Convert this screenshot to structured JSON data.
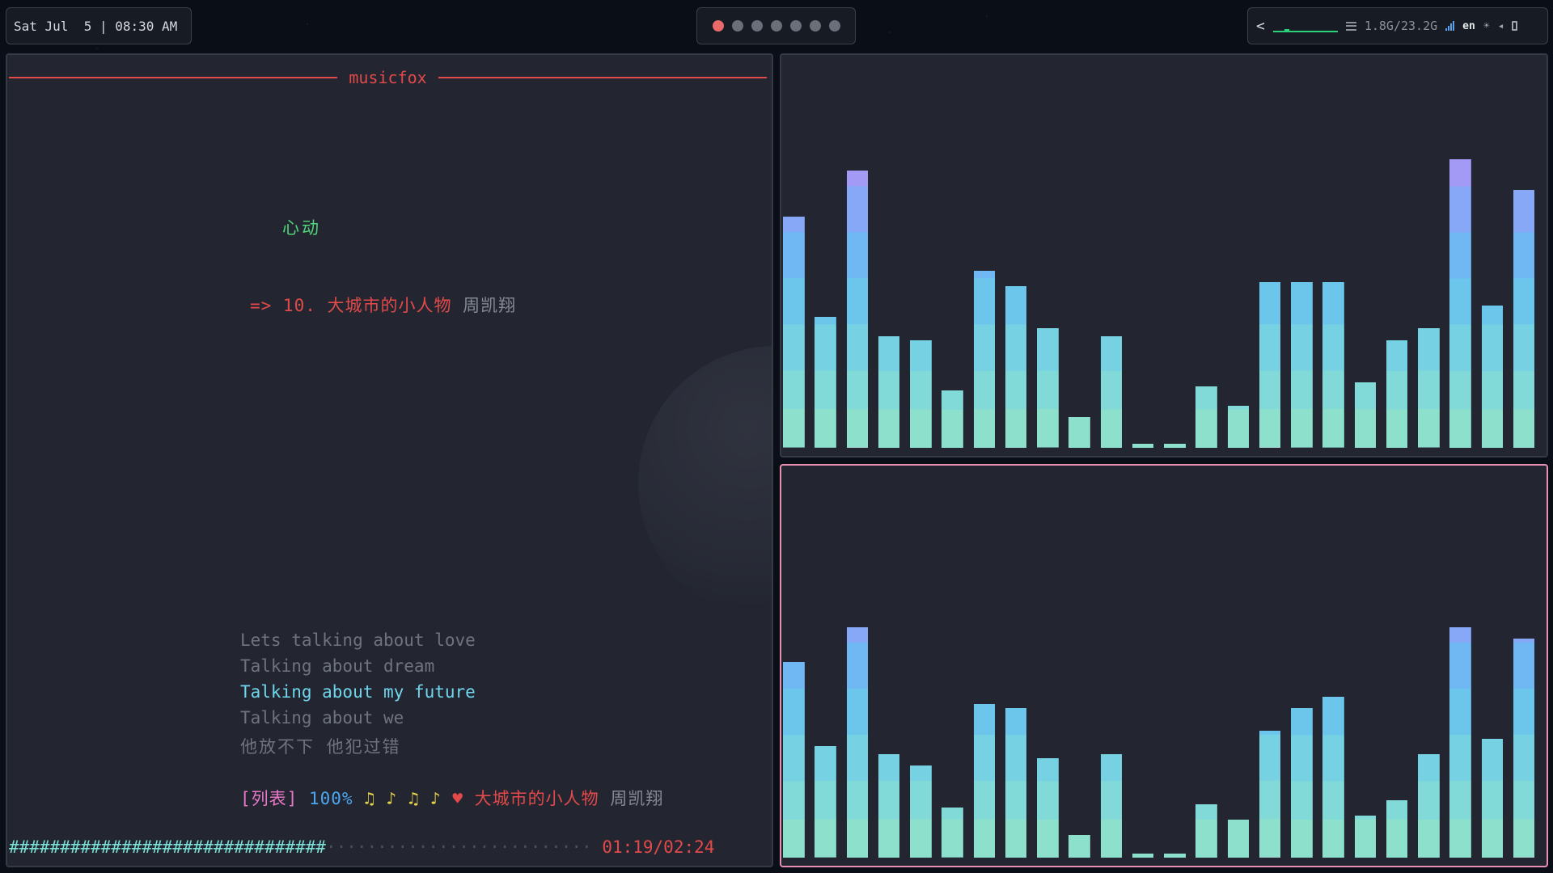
{
  "topbar": {
    "clock": "Sat Jul  5 | 08:30 AM",
    "workspaces": {
      "count": 7,
      "active_index": 0,
      "active_color": "#ea6a6a"
    },
    "tray": {
      "chevron": "<",
      "memory": "1.8G/23.2G",
      "lang": "en",
      "sun_glyph": "☀",
      "volume_glyph": "◂"
    }
  },
  "player": {
    "app_title": "musicfox",
    "playlist_name": "心动",
    "current_entry": {
      "prefix": "=> 10. 大城市的小人物",
      "artist": "周凯翔"
    },
    "lyrics": [
      "Lets talking about love",
      "Talking about dream",
      "Talking about my future",
      "Talking about we",
      "他放不下 他犯过错"
    ],
    "active_lyric_index": 2,
    "status": {
      "mode": "[列表]",
      "volume": "100%",
      "notes": "♫ ♪ ♫ ♪",
      "heart": "♥",
      "song": "大城市的小人物",
      "artist": "周凯翔"
    },
    "progress": {
      "done": "###############################",
      "rest": "··························",
      "time": "01:19/02:24",
      "fraction": 0.549
    }
  },
  "visualizer": {
    "top_levels": [
      0.6,
      0.34,
      0.72,
      0.29,
      0.28,
      0.15,
      0.46,
      0.42,
      0.31,
      0.08,
      0.29,
      0.01,
      0.01,
      0.16,
      0.11,
      0.43,
      0.43,
      0.43,
      0.17,
      0.28,
      0.31,
      0.75,
      0.37,
      0.67
    ],
    "bottom_levels": [
      0.51,
      0.29,
      0.6,
      0.27,
      0.24,
      0.13,
      0.4,
      0.39,
      0.26,
      0.06,
      0.27,
      0.01,
      0.01,
      0.14,
      0.1,
      0.33,
      0.39,
      0.42,
      0.11,
      0.15,
      0.27,
      0.6,
      0.31,
      0.57
    ]
  },
  "colors": {
    "accent_red": "#e24a4a",
    "lyric_active": "#6fd6ee",
    "playlist_green": "#4fd67a",
    "focus_border": "#e88fb2"
  }
}
